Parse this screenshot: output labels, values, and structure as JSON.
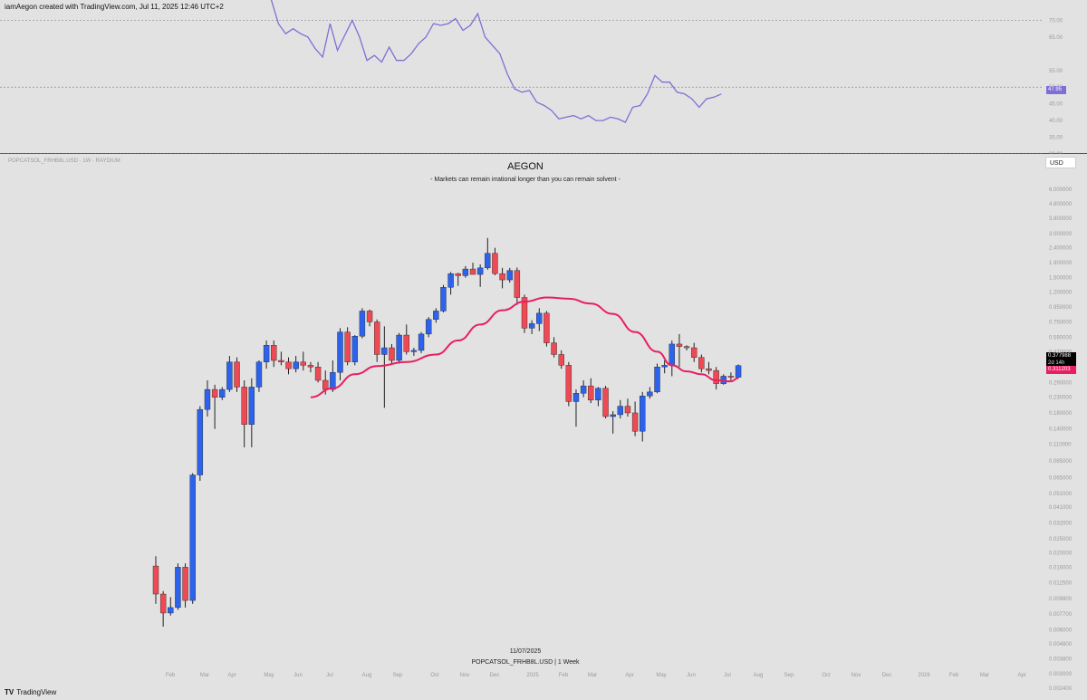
{
  "header": {
    "credit": "iamAegon created with TradingView.com, Jul 11, 2025 12:46 UTC+2"
  },
  "footer": {
    "brand": "TradingView",
    "date": "11/07/2025",
    "meta": "POPCATSOL_FRHB8L.USD | 1 Week"
  },
  "pane": {
    "symbol_line": "POPCATSOL_FRHB8L.USD · 1W · RAYDIUM",
    "title": "AEGON",
    "subtitle": "- Markets can remain irrational longer than you can remain solvent -",
    "currency": "USD",
    "last_price": "0.377988",
    "countdown": "2d 14h",
    "ma_value": "0.311203",
    "rsi_value": "47.95"
  },
  "colors": {
    "up": "#2d63ec",
    "down": "#ee4a55",
    "ma": "#e91e63",
    "rsi": "#7e6fd6",
    "background": "#e2e2e2"
  },
  "chart_data": [
    {
      "type": "line",
      "title": "",
      "series": [
        {
          "values": [
            81.5,
            76.5,
            69.0,
            66.0,
            67.5,
            66.0,
            65.0,
            61.5,
            59.0,
            69.0,
            61.0,
            65.5,
            70.0,
            65.0,
            58.0,
            59.5,
            57.5,
            62.0,
            58.0,
            58.0,
            60.0,
            63.0,
            65.0,
            69.0,
            68.5,
            69.0,
            70.5,
            67.0,
            68.5,
            72.0,
            65.0,
            62.5,
            60.0,
            54.0,
            49.5,
            48.5,
            49.0,
            45.5,
            44.5,
            43.0,
            40.5,
            41.0,
            41.5,
            40.5,
            41.5,
            40.0,
            40.0,
            41.0,
            40.5,
            39.5,
            44.0,
            44.5,
            48.0,
            53.5,
            51.5,
            51.5,
            48.5,
            48.0,
            46.5,
            44.0,
            46.5,
            47.0,
            47.95
          ]
        }
      ],
      "ylim": [
        30,
        75
      ],
      "y_ticks": [
        "70.00",
        "65.00",
        "55.00",
        "50.00",
        "45.00",
        "40.00",
        "35.00",
        "30.00"
      ],
      "reference_lines": [
        70,
        50,
        30
      ],
      "last_value": 47.95
    },
    {
      "type": "candlestick",
      "title": "AEGON",
      "scale": "log",
      "x_ticks": [
        "Feb",
        "Mar",
        "Apr",
        "May",
        "Jun",
        "Jul",
        "Aug",
        "Sep",
        "Oct",
        "Nov",
        "Dec",
        "2025",
        "Feb",
        "Mar",
        "Apr",
        "May",
        "Jun",
        "Jul",
        "Aug",
        "Sep",
        "Oct",
        "Nov",
        "Dec",
        "2026",
        "Feb",
        "Mar",
        "Apr"
      ],
      "y_ticks": [
        "6.000000",
        "4.800000",
        "3.800000",
        "3.000000",
        "2.400000",
        "1.900000",
        "1.500000",
        "1.200000",
        "0.950000",
        "0.750000",
        "0.590000",
        "0.470000",
        "0.370000",
        "0.290000",
        "0.230000",
        "0.180000",
        "0.140000",
        "0.110000",
        "0.085000",
        "0.065000",
        "0.051000",
        "0.041000",
        "0.032000",
        "0.025000",
        "0.020000",
        "0.016000",
        "0.012500",
        "0.009800",
        "0.007700",
        "0.006000",
        "0.004800",
        "0.003800",
        "0.003000",
        "0.002400",
        "0.001900",
        "0.001500"
      ],
      "candles": [
        {
          "o": 0.0163,
          "h": 0.019,
          "l": 0.009,
          "c": 0.0105
        },
        {
          "o": 0.0105,
          "h": 0.011,
          "l": 0.0063,
          "c": 0.0078
        },
        {
          "o": 0.0078,
          "h": 0.01,
          "l": 0.0075,
          "c": 0.0085
        },
        {
          "o": 0.0085,
          "h": 0.017,
          "l": 0.0082,
          "c": 0.016
        },
        {
          "o": 0.016,
          "h": 0.017,
          "l": 0.0085,
          "c": 0.0095
        },
        {
          "o": 0.0095,
          "h": 0.07,
          "l": 0.009,
          "c": 0.068
        },
        {
          "o": 0.068,
          "h": 0.2,
          "l": 0.062,
          "c": 0.19
        },
        {
          "o": 0.19,
          "h": 0.3,
          "l": 0.17,
          "c": 0.26
        },
        {
          "o": 0.26,
          "h": 0.28,
          "l": 0.14,
          "c": 0.23
        },
        {
          "o": 0.23,
          "h": 0.27,
          "l": 0.22,
          "c": 0.26
        },
        {
          "o": 0.26,
          "h": 0.44,
          "l": 0.25,
          "c": 0.4
        },
        {
          "o": 0.4,
          "h": 0.43,
          "l": 0.25,
          "c": 0.27
        },
        {
          "o": 0.27,
          "h": 0.3,
          "l": 0.105,
          "c": 0.15
        },
        {
          "o": 0.15,
          "h": 0.31,
          "l": 0.105,
          "c": 0.27
        },
        {
          "o": 0.27,
          "h": 0.41,
          "l": 0.25,
          "c": 0.4
        },
        {
          "o": 0.4,
          "h": 0.56,
          "l": 0.36,
          "c": 0.52
        },
        {
          "o": 0.52,
          "h": 0.56,
          "l": 0.37,
          "c": 0.41
        },
        {
          "o": 0.41,
          "h": 0.47,
          "l": 0.38,
          "c": 0.4
        },
        {
          "o": 0.4,
          "h": 0.43,
          "l": 0.33,
          "c": 0.36
        },
        {
          "o": 0.36,
          "h": 0.44,
          "l": 0.34,
          "c": 0.4
        },
        {
          "o": 0.4,
          "h": 0.47,
          "l": 0.35,
          "c": 0.38
        },
        {
          "o": 0.38,
          "h": 0.4,
          "l": 0.34,
          "c": 0.37
        },
        {
          "o": 0.37,
          "h": 0.4,
          "l": 0.29,
          "c": 0.3
        },
        {
          "o": 0.3,
          "h": 0.35,
          "l": 0.24,
          "c": 0.26
        },
        {
          "o": 0.26,
          "h": 0.41,
          "l": 0.25,
          "c": 0.34
        },
        {
          "o": 0.34,
          "h": 0.68,
          "l": 0.3,
          "c": 0.64
        },
        {
          "o": 0.64,
          "h": 0.69,
          "l": 0.38,
          "c": 0.4
        },
        {
          "o": 0.4,
          "h": 0.61,
          "l": 0.38,
          "c": 0.6
        },
        {
          "o": 0.6,
          "h": 0.93,
          "l": 0.58,
          "c": 0.89
        },
        {
          "o": 0.89,
          "h": 0.91,
          "l": 0.7,
          "c": 0.75
        },
        {
          "o": 0.75,
          "h": 0.78,
          "l": 0.4,
          "c": 0.45
        },
        {
          "o": 0.45,
          "h": 0.7,
          "l": 0.195,
          "c": 0.5
        },
        {
          "o": 0.5,
          "h": 0.53,
          "l": 0.39,
          "c": 0.41
        },
        {
          "o": 0.41,
          "h": 0.63,
          "l": 0.39,
          "c": 0.61
        },
        {
          "o": 0.61,
          "h": 0.72,
          "l": 0.45,
          "c": 0.47
        },
        {
          "o": 0.47,
          "h": 0.5,
          "l": 0.44,
          "c": 0.48
        },
        {
          "o": 0.48,
          "h": 0.64,
          "l": 0.46,
          "c": 0.62
        },
        {
          "o": 0.62,
          "h": 0.81,
          "l": 0.59,
          "c": 0.78
        },
        {
          "o": 0.78,
          "h": 0.93,
          "l": 0.74,
          "c": 0.89
        },
        {
          "o": 0.89,
          "h": 1.34,
          "l": 0.87,
          "c": 1.29
        },
        {
          "o": 1.29,
          "h": 1.64,
          "l": 1.15,
          "c": 1.6
        },
        {
          "o": 1.6,
          "h": 1.62,
          "l": 1.32,
          "c": 1.55
        },
        {
          "o": 1.55,
          "h": 1.8,
          "l": 1.5,
          "c": 1.72
        },
        {
          "o": 1.72,
          "h": 1.9,
          "l": 1.58,
          "c": 1.58
        },
        {
          "o": 1.58,
          "h": 1.85,
          "l": 1.3,
          "c": 1.75
        },
        {
          "o": 1.75,
          "h": 2.8,
          "l": 1.7,
          "c": 2.2
        },
        {
          "o": 2.2,
          "h": 2.4,
          "l": 1.56,
          "c": 1.6
        },
        {
          "o": 1.6,
          "h": 1.75,
          "l": 1.27,
          "c": 1.45
        },
        {
          "o": 1.45,
          "h": 1.75,
          "l": 1.39,
          "c": 1.68
        },
        {
          "o": 1.68,
          "h": 1.76,
          "l": 0.98,
          "c": 1.1
        },
        {
          "o": 1.1,
          "h": 1.15,
          "l": 0.63,
          "c": 0.68
        },
        {
          "o": 0.68,
          "h": 0.77,
          "l": 0.62,
          "c": 0.73
        },
        {
          "o": 0.73,
          "h": 0.93,
          "l": 0.65,
          "c": 0.86
        },
        {
          "o": 0.86,
          "h": 0.89,
          "l": 0.51,
          "c": 0.54
        },
        {
          "o": 0.54,
          "h": 0.59,
          "l": 0.43,
          "c": 0.45
        },
        {
          "o": 0.45,
          "h": 0.48,
          "l": 0.36,
          "c": 0.38
        },
        {
          "o": 0.38,
          "h": 0.4,
          "l": 0.2,
          "c": 0.215
        },
        {
          "o": 0.215,
          "h": 0.26,
          "l": 0.145,
          "c": 0.245
        },
        {
          "o": 0.245,
          "h": 0.3,
          "l": 0.23,
          "c": 0.275
        },
        {
          "o": 0.275,
          "h": 0.31,
          "l": 0.21,
          "c": 0.22
        },
        {
          "o": 0.22,
          "h": 0.27,
          "l": 0.2,
          "c": 0.265
        },
        {
          "o": 0.265,
          "h": 0.275,
          "l": 0.165,
          "c": 0.17
        },
        {
          "o": 0.17,
          "h": 0.185,
          "l": 0.13,
          "c": 0.175
        },
        {
          "o": 0.175,
          "h": 0.22,
          "l": 0.165,
          "c": 0.2
        },
        {
          "o": 0.2,
          "h": 0.225,
          "l": 0.17,
          "c": 0.18
        },
        {
          "o": 0.18,
          "h": 0.215,
          "l": 0.125,
          "c": 0.135
        },
        {
          "o": 0.135,
          "h": 0.25,
          "l": 0.115,
          "c": 0.235
        },
        {
          "o": 0.235,
          "h": 0.27,
          "l": 0.225,
          "c": 0.25
        },
        {
          "o": 0.25,
          "h": 0.39,
          "l": 0.245,
          "c": 0.37
        },
        {
          "o": 0.37,
          "h": 0.41,
          "l": 0.335,
          "c": 0.38
        },
        {
          "o": 0.38,
          "h": 0.56,
          "l": 0.32,
          "c": 0.53
        },
        {
          "o": 0.53,
          "h": 0.62,
          "l": 0.37,
          "c": 0.51
        },
        {
          "o": 0.51,
          "h": 0.52,
          "l": 0.48,
          "c": 0.5
        },
        {
          "o": 0.5,
          "h": 0.54,
          "l": 0.4,
          "c": 0.43
        },
        {
          "o": 0.43,
          "h": 0.45,
          "l": 0.34,
          "c": 0.36
        },
        {
          "o": 0.36,
          "h": 0.4,
          "l": 0.33,
          "c": 0.35
        },
        {
          "o": 0.35,
          "h": 0.37,
          "l": 0.26,
          "c": 0.285
        },
        {
          "o": 0.285,
          "h": 0.33,
          "l": 0.28,
          "c": 0.32
        },
        {
          "o": 0.32,
          "h": 0.34,
          "l": 0.3,
          "c": 0.315
        },
        {
          "o": 0.315,
          "h": 0.385,
          "l": 0.31,
          "c": 0.378
        }
      ],
      "moving_average": {
        "last_value": 0.311203,
        "points": [
          {
            "i": 21,
            "v": 0.23
          },
          {
            "i": 24,
            "v": 0.265
          },
          {
            "i": 27,
            "v": 0.33
          },
          {
            "i": 30,
            "v": 0.375
          },
          {
            "i": 34,
            "v": 0.4
          },
          {
            "i": 38,
            "v": 0.45
          },
          {
            "i": 41,
            "v": 0.56
          },
          {
            "i": 44,
            "v": 0.72
          },
          {
            "i": 47,
            "v": 0.9
          },
          {
            "i": 50,
            "v": 1.03
          },
          {
            "i": 53,
            "v": 1.1
          },
          {
            "i": 56,
            "v": 1.08
          },
          {
            "i": 59,
            "v": 1.0
          },
          {
            "i": 62,
            "v": 0.85
          },
          {
            "i": 65,
            "v": 0.64
          },
          {
            "i": 68,
            "v": 0.47
          },
          {
            "i": 70,
            "v": 0.38
          },
          {
            "i": 72,
            "v": 0.345
          },
          {
            "i": 74,
            "v": 0.33
          },
          {
            "i": 76,
            "v": 0.3
          },
          {
            "i": 78,
            "v": 0.295
          },
          {
            "i": 79,
            "v": 0.311
          }
        ]
      }
    }
  ]
}
